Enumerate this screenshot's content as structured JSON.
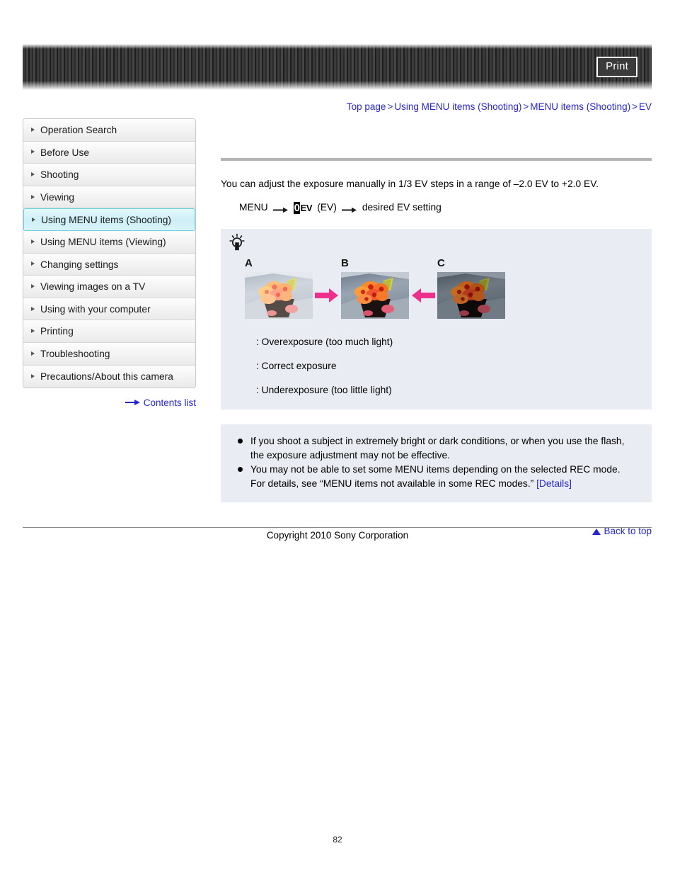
{
  "header": {
    "print_label": "Print",
    "print_icon": "printer-icon"
  },
  "breadcrumb": {
    "items": [
      "Top page",
      "Using MENU items (Shooting)",
      "MENU items (Shooting)",
      "EV"
    ],
    "separator": ">"
  },
  "sidebar": {
    "items": [
      {
        "label": "Operation Search",
        "active": false
      },
      {
        "label": "Before Use",
        "active": false
      },
      {
        "label": "Shooting",
        "active": false
      },
      {
        "label": "Viewing",
        "active": false
      },
      {
        "label": "Using MENU items (Shooting)",
        "active": true
      },
      {
        "label": "Using MENU items (Viewing)",
        "active": false
      },
      {
        "label": "Changing settings",
        "active": false
      },
      {
        "label": "Viewing images on a TV",
        "active": false
      },
      {
        "label": "Using with your computer",
        "active": false
      },
      {
        "label": "Printing",
        "active": false
      },
      {
        "label": "Troubleshooting",
        "active": false
      },
      {
        "label": "Precautions/About this camera",
        "active": false
      }
    ],
    "contents_list_label": "Contents list"
  },
  "main": {
    "intro": "You can adjust the exposure manually in 1/3 EV steps in a range of –2.0 EV to +2.0 EV.",
    "menu_path": {
      "start": "MENU",
      "icon_glyph": "0",
      "icon_suffix": "EV",
      "icon_paren": "(EV)",
      "end": "desired EV setting"
    },
    "tip": {
      "icon": "lightbulb-tip-icon",
      "samples": [
        {
          "letter": "A",
          "exposure": "over"
        },
        {
          "letter": "B",
          "exposure": "correct"
        },
        {
          "letter": "C",
          "exposure": "under"
        }
      ],
      "arrow_color": "#ee2f8e",
      "captions": [
        ": Overexposure (too much light)",
        ": Correct exposure",
        ": Underexposure (too little light)"
      ]
    },
    "notes": [
      {
        "text": "If you shoot a subject in extremely bright or dark conditions, or when you use the flash, the exposure adjustment may not be effective.",
        "link": ""
      },
      {
        "text": "You may not be able to set some MENU items depending on the selected REC mode. For details, see “MENU items not available in some REC modes.” ",
        "link": "[Details]"
      }
    ],
    "back_to_top": "Back to top"
  },
  "footer": {
    "copyright": "Copyright 2010 Sony Corporation",
    "page_number": "82"
  },
  "colors": {
    "link": "#2626cc",
    "panel_bg": "#e9ecf2",
    "active_sidebar": "#cdeff6",
    "arrow_pink": "#ee2f8e"
  }
}
